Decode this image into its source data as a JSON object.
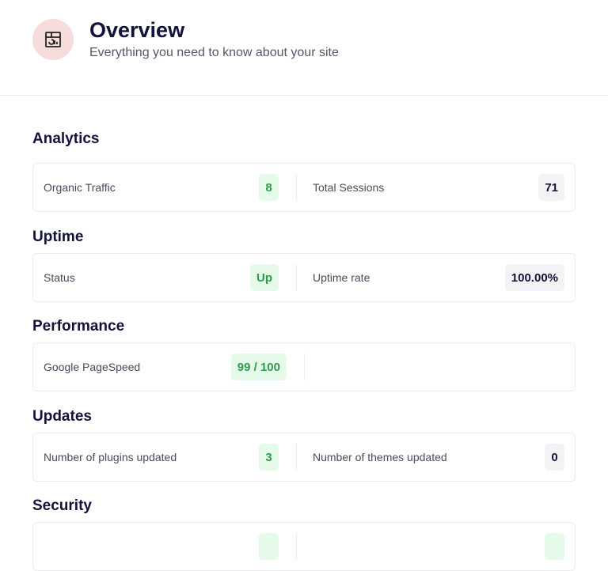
{
  "header": {
    "title": "Overview",
    "subtitle": "Everything you need to know about your site",
    "icon": "dashboard-icon"
  },
  "sections": [
    {
      "title": "Analytics",
      "left": {
        "label": "Organic Traffic",
        "value": "8"
      },
      "right": {
        "label": "Total Sessions",
        "value": "71"
      }
    },
    {
      "title": "Uptime",
      "left": {
        "label": "Status",
        "value": "Up"
      },
      "right": {
        "label": "Uptime rate",
        "value": "100.00%"
      }
    },
    {
      "title": "Performance",
      "left": {
        "label": "Google PageSpeed",
        "value": "99 / 100"
      }
    },
    {
      "title": "Updates",
      "left": {
        "label": "Number of plugins updated",
        "value": "3"
      },
      "right": {
        "label": "Number of themes updated",
        "value": "0"
      }
    },
    {
      "title": "Security"
    }
  ],
  "colors": {
    "accent_green": "#2f9a4a",
    "title": "#12123a",
    "logo_bg": "#f7dcdc"
  }
}
